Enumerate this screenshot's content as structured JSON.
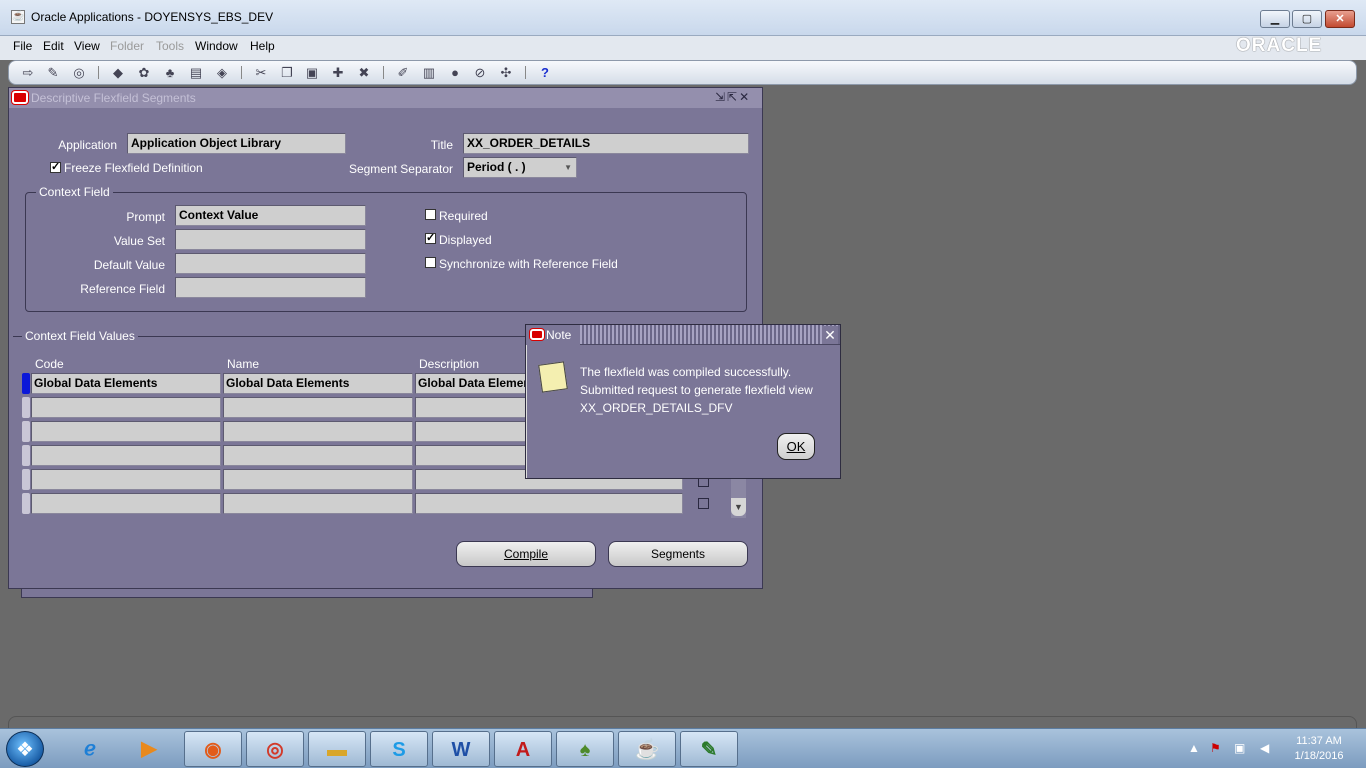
{
  "window": {
    "title": "Oracle Applications - DOYENSYS_EBS_DEV",
    "app_icon": "java-cup-icon",
    "min": "▁",
    "max": "▢",
    "close": "✕"
  },
  "menubar": {
    "items": [
      {
        "label": "File",
        "enabled": true
      },
      {
        "label": "Edit",
        "enabled": true
      },
      {
        "label": "View",
        "enabled": true
      },
      {
        "label": "Folder",
        "enabled": false
      },
      {
        "label": "Tools",
        "enabled": false
      },
      {
        "label": "Window",
        "enabled": true
      },
      {
        "label": "Help",
        "enabled": true
      }
    ],
    "logo": "ORACLE"
  },
  "toolbar": {
    "icons": [
      "new-icon",
      "find-icon",
      "navigator-icon",
      "save-icon",
      "next-step-icon",
      "switch-responsibility-icon",
      "print-icon",
      "close-form-icon",
      "cut-icon",
      "copy-icon",
      "paste-icon",
      "new-record-icon",
      "delete-record-icon",
      "edit-field-icon",
      "zoom-icon",
      "translations-icon",
      "attachments-icon",
      "folder-tools-icon",
      "help-icon"
    ],
    "help_glyph": "?"
  },
  "form": {
    "title": "Descriptive Flexfield Segments",
    "application_label": "Application",
    "application_value": "Application Object Library",
    "title_label": "Title",
    "title_value": "XX_ORDER_DETAILS",
    "freeze_label": "Freeze Flexfield Definition",
    "freeze_checked": true,
    "separator_label": "Segment Separator",
    "separator_value": "Period ( . )",
    "context_field": {
      "group_title": "Context Field",
      "prompt_label": "Prompt",
      "prompt_value": "Context Value",
      "value_set_label": "Value Set",
      "default_value_label": "Default Value",
      "reference_field_label": "Reference Field",
      "required_label": "Required",
      "required_checked": false,
      "displayed_label": "Displayed",
      "displayed_checked": true,
      "sync_label": "Synchronize with Reference Field",
      "sync_checked": false
    },
    "context_values": {
      "group_title": "Context Field Values",
      "col_code": "Code",
      "col_name": "Name",
      "col_description": "Description",
      "rows": [
        {
          "code": "Global Data Elements",
          "name": "Global Data Elements",
          "description": "Global Data Elements"
        }
      ]
    },
    "compile_label": "Compile",
    "segments_label": "Segments"
  },
  "note": {
    "title": "Note",
    "line1": "The flexfield was compiled successfully.",
    "line2": "Submitted request to generate flexfield view",
    "line3": "XX_ORDER_DETAILS_DFV",
    "ok_label": "OK"
  },
  "taskbar": {
    "apps": [
      "internet-explorer-icon",
      "media-player-icon",
      "firefox-icon",
      "chrome-icon",
      "file-explorer-icon",
      "skype-icon",
      "word-icon",
      "acrobat-icon",
      "toad-icon",
      "java-icon",
      "notepad-icon"
    ],
    "time": "11:37 AM",
    "date": "1/18/2016"
  }
}
